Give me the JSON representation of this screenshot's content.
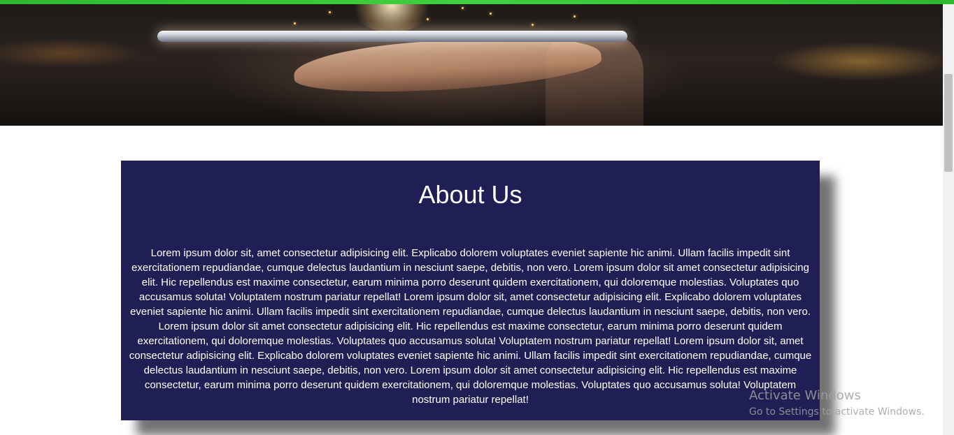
{
  "about": {
    "title": "About Us",
    "body": "Lorem ipsum dolor sit, amet consectetur adipisicing elit. Explicabo dolorem voluptates eveniet sapiente hic animi. Ullam facilis impedit sint exercitationem repudiandae, cumque delectus laudantium in nesciunt saepe, debitis, non vero. Lorem ipsum dolor sit amet consectetur adipisicing elit. Hic repellendus est maxime consectetur, earum minima porro deserunt quidem exercitationem, qui doloremque molestias. Voluptates quo accusamus soluta! Voluptatem nostrum pariatur repellat! Lorem ipsum dolor sit, amet consectetur adipisicing elit. Explicabo dolorem voluptates eveniet sapiente hic animi. Ullam facilis impedit sint exercitationem repudiandae, cumque delectus laudantium in nesciunt saepe, debitis, non vero. Lorem ipsum dolor sit amet consectetur adipisicing elit. Hic repellendus est maxime consectetur, earum minima porro deserunt quidem exercitationem, qui doloremque molestias. Voluptates quo accusamus soluta! Voluptatem nostrum pariatur repellat! Lorem ipsum dolor sit, amet consectetur adipisicing elit. Explicabo dolorem voluptates eveniet sapiente hic animi. Ullam facilis impedit sint exercitationem repudiandae, cumque delectus laudantium in nesciunt saepe, debitis, non vero. Lorem ipsum dolor sit amet consectetur adipisicing elit. Hic repellendus est maxime consectetur, earum minima porro deserunt quidem exercitationem, qui doloremque molestias. Voluptates quo accusamus soluta! Voluptatem nostrum pariatur repellat!"
  },
  "watermark": {
    "title": "Activate Windows",
    "subtitle": "Go to Settings to activate Windows."
  },
  "colors": {
    "accent_bar": "#3fd13f",
    "card_background": "#1f1f55",
    "card_text": "#ffffff"
  },
  "hero": {
    "image": "hand-holding-tablet-photo"
  }
}
